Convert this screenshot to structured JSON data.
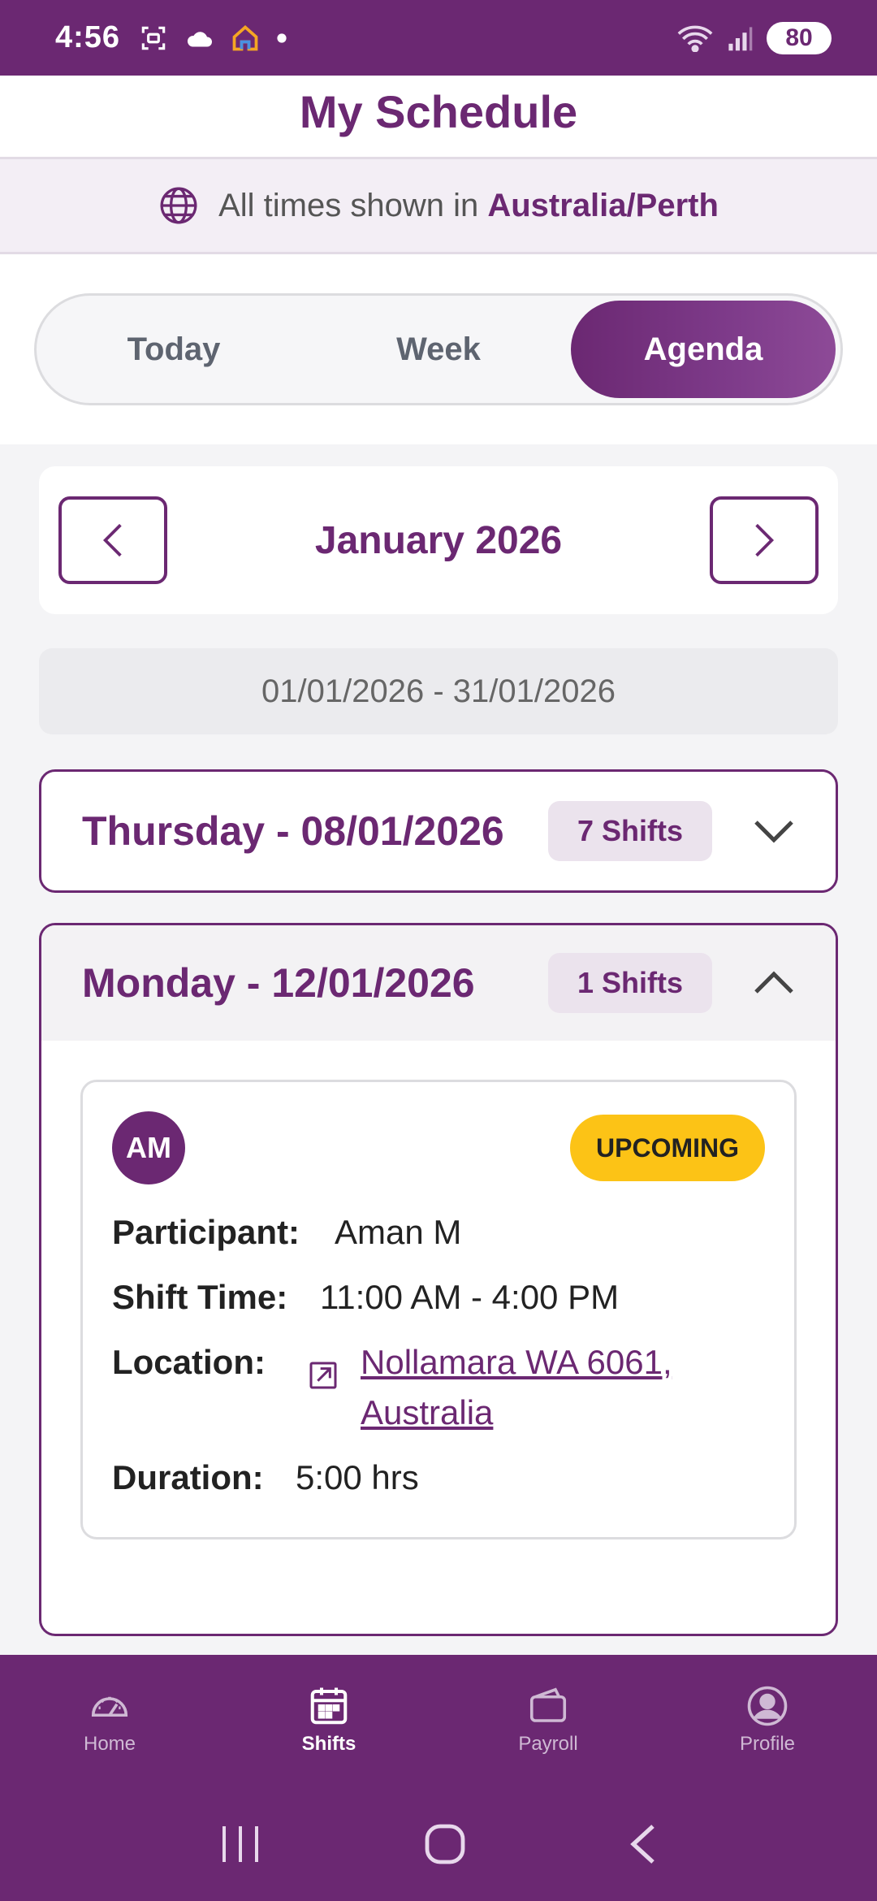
{
  "status_bar": {
    "time": "4:56",
    "battery": "80"
  },
  "header": {
    "title": "My Schedule"
  },
  "timezone": {
    "prefix": "All times shown in",
    "zone": "Australia/Perth"
  },
  "tabs": [
    {
      "label": "Today",
      "active": false
    },
    {
      "label": "Week",
      "active": false
    },
    {
      "label": "Agenda",
      "active": true
    }
  ],
  "month": {
    "title": "January 2026",
    "range": "01/01/2026 - 31/01/2026"
  },
  "days": [
    {
      "title": "Thursday - 08/01/2026",
      "badge": "7 Shifts",
      "expanded": false
    },
    {
      "title": "Monday - 12/01/2026",
      "badge": "1 Shifts",
      "expanded": true,
      "shift": {
        "initials": "AM",
        "status": "UPCOMING",
        "participant_label": "Participant:",
        "participant": "Aman M",
        "time_label": "Shift Time:",
        "time": "11:00 AM - 4:00 PM",
        "location_label": "Location:",
        "location_line1": "Nollamara WA 6061,",
        "location_line2": "Australia",
        "duration_label": "Duration:",
        "duration": "5:00 hrs"
      }
    }
  ],
  "bottom_nav": [
    {
      "label": "Home",
      "icon": "gauge-icon",
      "active": false
    },
    {
      "label": "Shifts",
      "icon": "calendar-icon",
      "active": true
    },
    {
      "label": "Payroll",
      "icon": "wallet-icon",
      "active": false
    },
    {
      "label": "Profile",
      "icon": "user-icon",
      "active": false
    }
  ],
  "colors": {
    "brand": "#6b2872",
    "status_upcoming": "#fcc316"
  }
}
